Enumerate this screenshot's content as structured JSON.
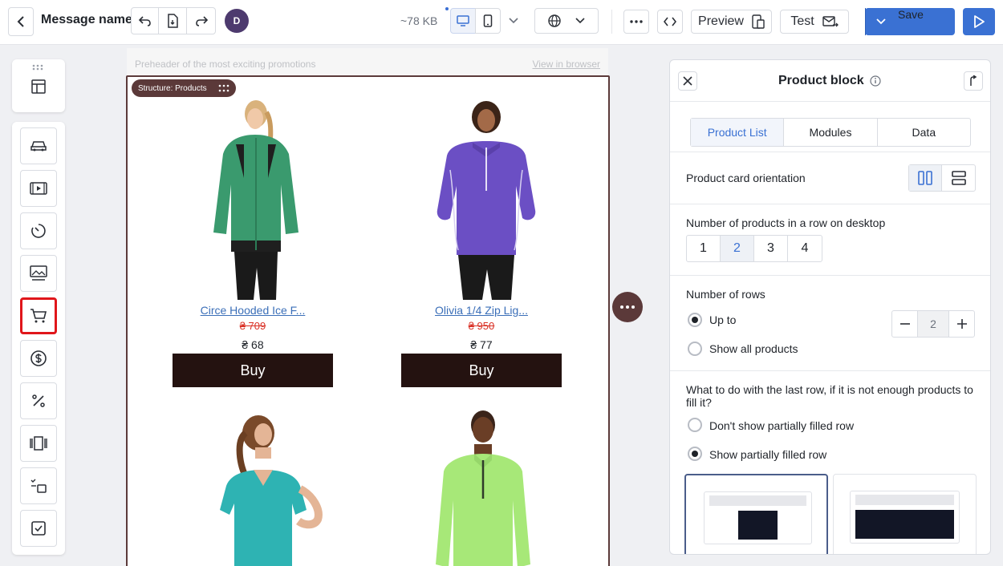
{
  "header": {
    "title": "Message name",
    "avatar_letter": "D",
    "size": "~78 KB",
    "preview_label": "Preview",
    "test_label": "Test",
    "save_label": "Save"
  },
  "canvas": {
    "preheader": "Preheader of the most exciting promotions",
    "view_in_browser": "View in browser",
    "structure_label": "Structure: Products",
    "products": [
      {
        "name": "Circe Hooded Ice F...",
        "old_price": "₴ 709",
        "price": "₴ 68",
        "buy": "Buy"
      },
      {
        "name": "Olivia 1/4 Zip Lig...",
        "old_price": "₴ 950",
        "price": "₴ 77",
        "buy": "Buy"
      }
    ]
  },
  "panel": {
    "title": "Product block",
    "tabs": [
      "Product List",
      "Modules",
      "Data"
    ],
    "orientation_label": "Product card orientation",
    "per_row_label": "Number of products in a row on desktop",
    "per_row_options": [
      "1",
      "2",
      "3",
      "4"
    ],
    "per_row_selected": "2",
    "rows_label": "Number of rows",
    "rows_up_to": "Up to",
    "rows_show_all": "Show all products",
    "rows_value": "2",
    "last_row_question": "What to do with the last row, if it is not enough products to fill it?",
    "last_row_hide": "Don't show partially filled row",
    "last_row_show": "Show partially filled row"
  },
  "colors": {
    "accent": "#3a71d3",
    "structure": "#5b3939",
    "buy_button": "#241210",
    "old_price": "#d93025",
    "highlight": "#e0161b"
  },
  "icons": [
    "back-icon",
    "undo-icon",
    "save-copy-icon",
    "redo-icon",
    "desktop-icon",
    "mobile-icon",
    "globe-icon",
    "more-icon",
    "code-icon",
    "preview-icon",
    "test-mail-icon",
    "play-icon",
    "close-icon",
    "info-icon",
    "collapse-icon"
  ]
}
